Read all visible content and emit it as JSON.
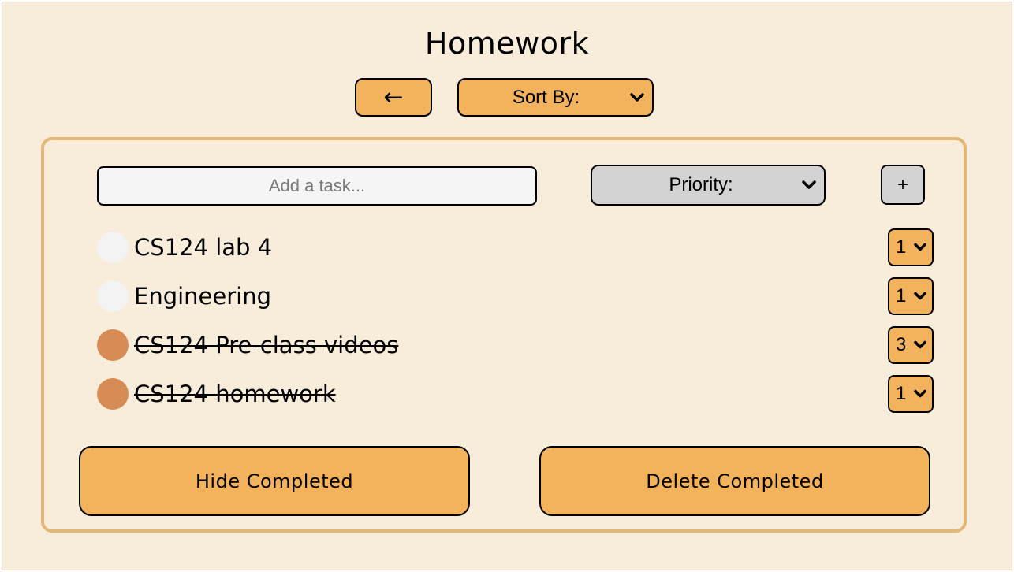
{
  "header": {
    "title": "Homework",
    "back_label": "←",
    "sort_label": "Sort By:"
  },
  "composer": {
    "input_value": "",
    "input_placeholder": "Add a task...",
    "priority_label": "Priority:",
    "add_label": "+"
  },
  "tasks": [
    {
      "label": "CS124 lab 4",
      "completed": false,
      "priority": "1"
    },
    {
      "label": "Engineering",
      "completed": false,
      "priority": "1"
    },
    {
      "label": "CS124 Pre-class videos",
      "completed": true,
      "priority": "3"
    },
    {
      "label": "CS124 homework",
      "completed": true,
      "priority": "1"
    }
  ],
  "footer": {
    "hide_label": "Hide Completed",
    "delete_label": "Delete Completed"
  },
  "colors": {
    "background": "#f8ecda",
    "accent": "#f3b35d",
    "panel_border": "#e2b777",
    "completed_dot": "#d78c55",
    "incomplete_dot": "#f3f3f3",
    "control_gray": "#d3d3d3"
  }
}
